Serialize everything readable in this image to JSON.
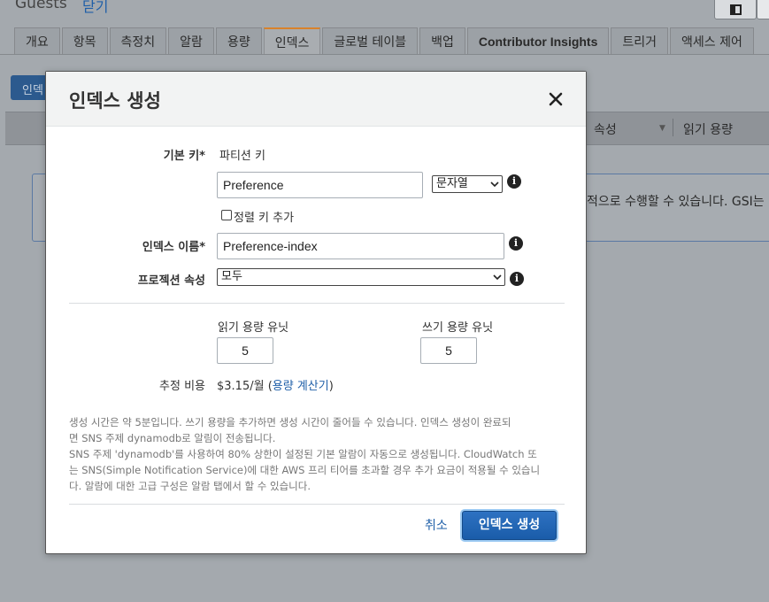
{
  "page": {
    "title": "Guests",
    "close_link": "닫기"
  },
  "tabs": [
    {
      "label": "개요"
    },
    {
      "label": "항목"
    },
    {
      "label": "측정치"
    },
    {
      "label": "알람"
    },
    {
      "label": "용량"
    },
    {
      "label": "인덱스",
      "active": true
    },
    {
      "label": "글로벌 테이블"
    },
    {
      "label": "백업"
    },
    {
      "label": "Contributor Insights"
    },
    {
      "label": "트리거"
    },
    {
      "label": "액세스 제어"
    }
  ],
  "background": {
    "create_button": "인덱스 생성",
    "table_columns": [
      "속성",
      "읽기 용량"
    ],
    "info_text": "적으로 수행할 수 있습니다. GSI는"
  },
  "modal": {
    "title": "인덱스 생성",
    "primary_key_label": "기본 키*",
    "partition_key_label": "파티션 키",
    "partition_key_value": "Preference",
    "partition_key_type": "문자열",
    "add_sort_key_label": "정렬 키 추가",
    "add_sort_key_checked": false,
    "index_name_label": "인덱스 이름*",
    "index_name_value": "Preference-index",
    "projection_label": "프로젝션 속성",
    "projection_value": "모두",
    "read_capacity_label": "읽기 용량 유닛",
    "read_capacity_value": "5",
    "write_capacity_label": "쓰기 용량 유닛",
    "write_capacity_value": "5",
    "estimated_cost_label": "추정 비용",
    "estimated_cost_value": "$3.15/월",
    "capacity_calculator_link": "용량 계산기",
    "note_lines": [
      "생성 시간은 약 5분입니다. 쓰기 용량을 추가하면 생성 시간이 줄어들 수 있습니다. 인덱스 생성이 완료되",
      "면 SNS 주제 dynamodb로 알림이 전송됩니다.",
      "SNS 주제 'dynamodb'를 사용하여 80% 상한이 설정된 기본 알람이 자동으로 생성됩니다. CloudWatch 또",
      "는 SNS(Simple Notification Service)에 대한 AWS 프리 티어를 초과할 경우 추가 요금이 적용될 수 있습니",
      "다. 알람에 대한 고급 구성은 알람 탭에서 할 수 있습니다."
    ],
    "cancel_label": "취소",
    "create_label": "인덱스 생성"
  }
}
